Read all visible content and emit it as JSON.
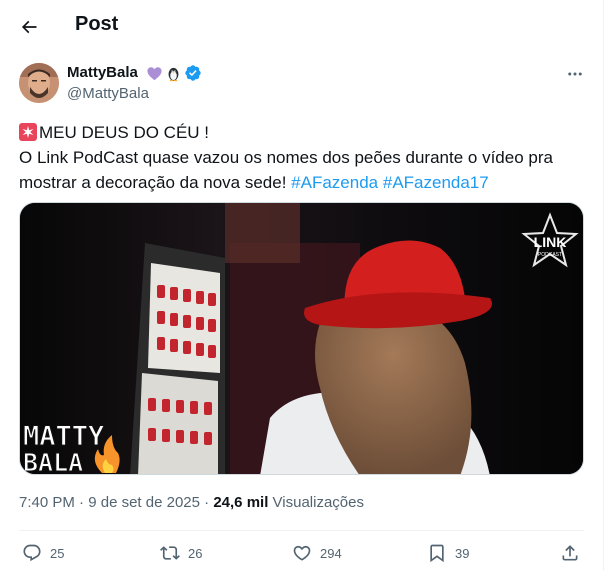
{
  "header": {
    "title": "Post",
    "back_icon": "arrow-left-icon"
  },
  "author": {
    "name": "MattyBala",
    "handle": "@MattyBala",
    "badges": [
      "purple-heart-icon",
      "penguin-icon",
      "verified-badge-icon"
    ]
  },
  "tweet": {
    "line1": "MEU DEUS DO CÉU !",
    "line2": "O Link PodCast quase vazou os nomes dos peões durante o vídeo pra",
    "line3_text": "mostrar a decoração da nova sede! ",
    "hashtag1": "#AFazenda",
    "hashtag2": "#AFazenda17"
  },
  "media": {
    "watermark_top_right": "LINK",
    "watermark_top_right_small": "PODCAST",
    "watermark_bottom_left_1": "MATTY",
    "watermark_bottom_left_2": "BALA"
  },
  "meta": {
    "time": "7:40 PM",
    "date": "9 de set de 2025",
    "separator": "·",
    "views_count": "24,6 mil",
    "views_label": "Visualizações"
  },
  "actions": {
    "replies": "25",
    "reposts": "26",
    "likes": "294",
    "bookmarks": "39"
  },
  "colors": {
    "link": "#1d9bf0",
    "secondary_text": "#536471",
    "verified": "#1d9bf0"
  }
}
